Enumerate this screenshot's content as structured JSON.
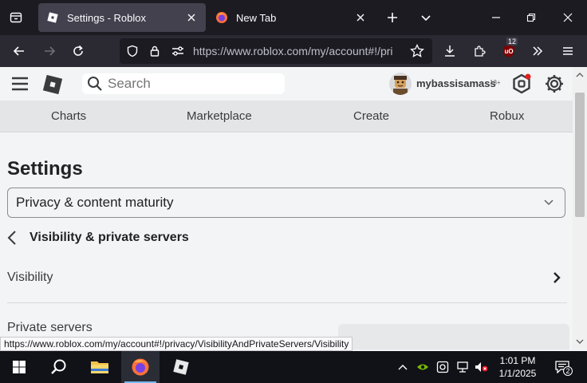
{
  "browser": {
    "tabs": [
      {
        "title": "Settings - Roblox",
        "active": true
      },
      {
        "title": "New Tab",
        "active": false
      }
    ],
    "url": "https://www.roblox.com/my/account#!/pri",
    "extension_badge": "12",
    "status_url": "https://www.roblox.com/my/account#!/privacy/VisibilityAndPrivateServers/Visibility"
  },
  "roblox": {
    "search_placeholder": "Search",
    "username": "mybassisamass",
    "age_label": "13+",
    "nav": [
      "Charts",
      "Marketplace",
      "Create",
      "Robux"
    ],
    "page_title": "Settings",
    "category_value": "Privacy & content maturity",
    "section_title": "Visibility & private servers",
    "rows": [
      {
        "label": "Visibility"
      },
      {
        "label": "Private servers"
      }
    ]
  },
  "taskbar": {
    "time": "1:01 PM",
    "date": "1/1/2025",
    "notifications": "2"
  },
  "colors": {
    "tab_strip": "#1c1b22",
    "nav_bar": "#2b2a33",
    "page_bg": "#f2f4f5",
    "taskbar": "#101217"
  }
}
